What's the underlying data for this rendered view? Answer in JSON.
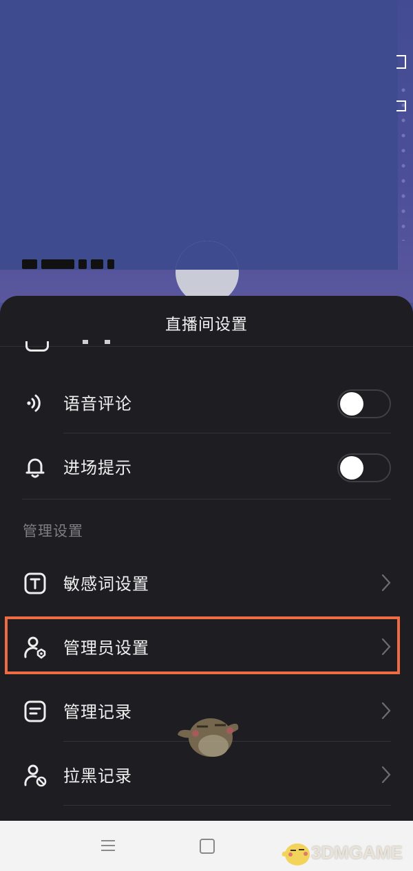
{
  "sheet": {
    "title": "直播间设置",
    "rows": [
      {
        "label": "语音评论",
        "icon": "voice-icon",
        "toggle_on": false
      },
      {
        "label": "进场提示",
        "icon": "bell-icon",
        "toggle_on": false
      }
    ],
    "section_title": "管理设置",
    "nav_rows": [
      {
        "label": "敏感词设置",
        "icon": "text-t-icon"
      },
      {
        "label": "管理员设置",
        "icon": "user-shield-icon",
        "highlighted": true
      },
      {
        "label": "管理记录",
        "icon": "document-icon"
      },
      {
        "label": "拉黑记录",
        "icon": "user-block-icon"
      }
    ]
  },
  "watermark": {
    "text": "3DMGAME"
  },
  "colors": {
    "highlight": "#ef6b43",
    "sheet_bg": "#1e1e22",
    "banner_bg": "#3e4b8e"
  }
}
